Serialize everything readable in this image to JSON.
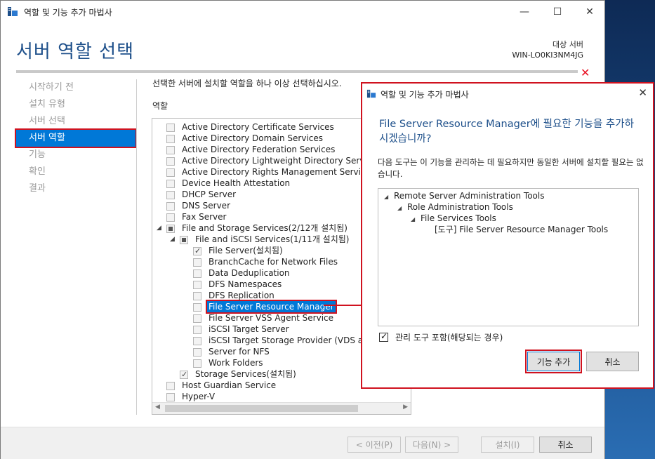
{
  "window": {
    "title": "역할 및 기능 추가 마법사",
    "controls": {
      "minimize": "—",
      "maximize": "☐",
      "close": "✕"
    }
  },
  "header": {
    "page_title": "서버 역할 선택",
    "target_label": "대상 서버",
    "target_server": "WIN-LO0KI3NM4JG",
    "close_mark": "✕"
  },
  "nav": {
    "items": [
      {
        "label": "시작하기 전",
        "active": false
      },
      {
        "label": "설치 유형",
        "active": false
      },
      {
        "label": "서버 선택",
        "active": false
      },
      {
        "label": "서버 역할",
        "active": true
      },
      {
        "label": "기능",
        "active": false
      },
      {
        "label": "확인",
        "active": false
      },
      {
        "label": "결과",
        "active": false
      }
    ]
  },
  "main": {
    "instruction": "선택한 서버에 설치할 역할을 하나 이상 선택하십시오.",
    "roles_label": "역할",
    "roles": [
      {
        "label": "Active Directory Certificate Services",
        "level": 0,
        "state": "unchecked",
        "expander": ""
      },
      {
        "label": "Active Directory Domain Services",
        "level": 0,
        "state": "unchecked",
        "expander": ""
      },
      {
        "label": "Active Directory Federation Services",
        "level": 0,
        "state": "unchecked",
        "expander": ""
      },
      {
        "label": "Active Directory Lightweight Directory Services",
        "level": 0,
        "state": "unchecked",
        "expander": ""
      },
      {
        "label": "Active Directory Rights Management Services",
        "level": 0,
        "state": "unchecked",
        "expander": ""
      },
      {
        "label": "Device Health Attestation",
        "level": 0,
        "state": "unchecked",
        "expander": ""
      },
      {
        "label": "DHCP Server",
        "level": 0,
        "state": "unchecked",
        "expander": ""
      },
      {
        "label": "DNS Server",
        "level": 0,
        "state": "unchecked",
        "expander": ""
      },
      {
        "label": "Fax Server",
        "level": 0,
        "state": "unchecked",
        "expander": ""
      },
      {
        "label": "File and Storage Services(2/12개 설치됨)",
        "level": 0,
        "state": "partial",
        "expander": "◢"
      },
      {
        "label": "File and iSCSI Services(1/11개 설치됨)",
        "level": 1,
        "state": "partial",
        "expander": "◢"
      },
      {
        "label": "File Server(설치됨)",
        "level": 2,
        "state": "checked",
        "expander": ""
      },
      {
        "label": "BranchCache for Network Files",
        "level": 2,
        "state": "unchecked",
        "expander": ""
      },
      {
        "label": "Data Deduplication",
        "level": 2,
        "state": "unchecked",
        "expander": ""
      },
      {
        "label": "DFS Namespaces",
        "level": 2,
        "state": "unchecked",
        "expander": ""
      },
      {
        "label": "DFS Replication",
        "level": 2,
        "state": "unchecked",
        "expander": ""
      },
      {
        "label": "File Server Resource Manager",
        "level": 2,
        "state": "unchecked",
        "expander": "",
        "selected": true
      },
      {
        "label": "File Server VSS Agent Service",
        "level": 2,
        "state": "unchecked",
        "expander": ""
      },
      {
        "label": "iSCSI Target Server",
        "level": 2,
        "state": "unchecked",
        "expander": ""
      },
      {
        "label": "iSCSI Target Storage Provider (VDS and VSS hardware providers)",
        "level": 2,
        "state": "unchecked",
        "expander": ""
      },
      {
        "label": "Server for NFS",
        "level": 2,
        "state": "unchecked",
        "expander": ""
      },
      {
        "label": "Work Folders",
        "level": 2,
        "state": "unchecked",
        "expander": ""
      },
      {
        "label": "Storage Services(설치됨)",
        "level": 1,
        "state": "checked",
        "expander": ""
      },
      {
        "label": "Host Guardian Service",
        "level": 0,
        "state": "unchecked",
        "expander": ""
      },
      {
        "label": "Hyper-V",
        "level": 0,
        "state": "unchecked",
        "expander": ""
      }
    ]
  },
  "footer": {
    "prev": "< 이전(P)",
    "next": "다음(N) >",
    "install": "설치(I)",
    "cancel": "취소"
  },
  "dialog": {
    "title": "역할 및 기능 추가 마법사",
    "close": "✕",
    "heading": "File Server Resource Manager에 필요한 기능을 추가하시겠습니까?",
    "body": "다음 도구는 이 기능을 관리하는 데 필요하지만 동일한 서버에 설치할 필요는 없습니다.",
    "features": [
      {
        "label": "Remote Server Administration Tools",
        "level": 0,
        "expander": "◢"
      },
      {
        "label": "Role Administration Tools",
        "level": 1,
        "expander": "◢"
      },
      {
        "label": "File Services Tools",
        "level": 2,
        "expander": "◢"
      },
      {
        "label": "[도구] File Server Resource Manager Tools",
        "level": 3,
        "expander": ""
      }
    ],
    "include_tools": "관리 도구 포함(해당되는 경우)",
    "add_button": "기능 추가",
    "cancel_button": "취소"
  }
}
